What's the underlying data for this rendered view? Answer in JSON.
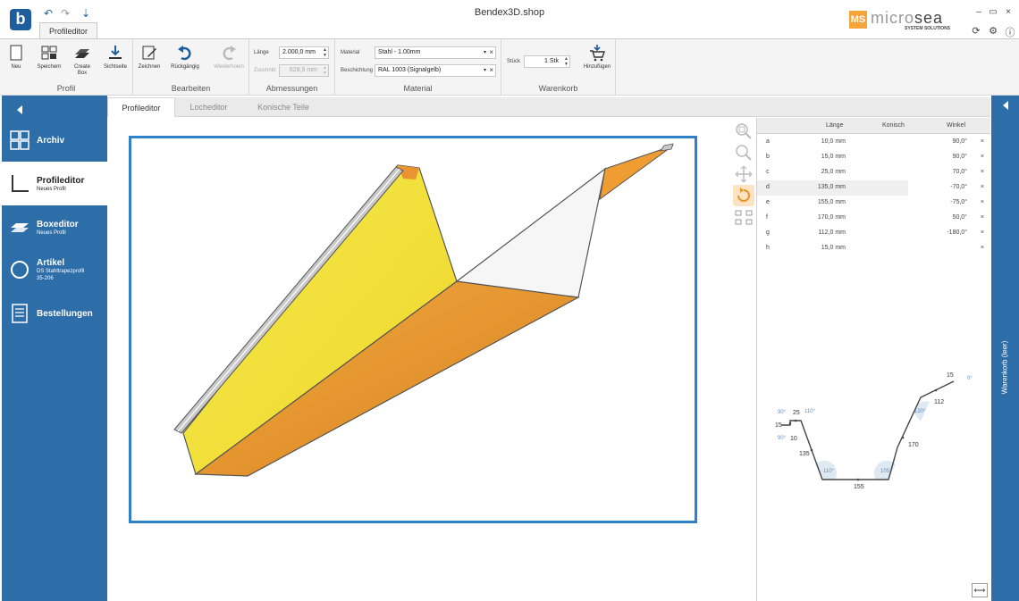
{
  "app": {
    "title": "Bendex3D.shop",
    "active_ribbon_tab": "Profileditor",
    "brand": {
      "mark": "MS",
      "word_light": "micro",
      "word_dark": "sea",
      "sub": "SYSTEM SOLUTIONS"
    }
  },
  "window": {
    "minimize": "–",
    "restore": "▭",
    "close": "×"
  },
  "ribbon": {
    "groups": {
      "profil": "Profil",
      "bearbeiten": "Bearbeiten",
      "abmessungen": "Abmessungen",
      "material": "Material",
      "warenkorb": "Warenkorb"
    },
    "buttons": {
      "neu": "Neu",
      "speichern": "Speichern",
      "create_box_1": "Create",
      "create_box_2": "Box",
      "sichtseite": "Sichtseite",
      "zeichnen": "Zeichnen",
      "rueckgaengig": "Rückgängig",
      "wiederholen": "Wiederholen",
      "hinzufuegen": "Hinzufügen"
    },
    "fields": {
      "laenge_label": "Länge",
      "laenge_value": "2.000,0 mm",
      "zuschnitt_label": "Zuschnitt",
      "zuschnitt_value": "628,9 mm",
      "material_label": "Material",
      "material_value": "Stahl - 1.00mm",
      "beschichtung_label": "Beschichtung",
      "beschichtung_value": "RAL 1003 (Signalgelb)",
      "stueck_label": "Stück",
      "stueck_value": "1 Stk"
    }
  },
  "sidebar": {
    "items": [
      {
        "title": "Archiv",
        "sub": ""
      },
      {
        "title": "Profileditor",
        "sub": "Neues Profil"
      },
      {
        "title": "Boxeditor",
        "sub": "Neues Profil"
      },
      {
        "title": "Artikel",
        "sub": "DS Stahltrapezprofil",
        "sub2": "35-206"
      },
      {
        "title": "Bestellungen",
        "sub": ""
      }
    ]
  },
  "tabs": [
    "Profileditor",
    "Locheditor",
    "Konische Teile"
  ],
  "table": {
    "headers": {
      "laenge": "Länge",
      "konisch": "Konisch",
      "winkel": "Winkel"
    },
    "rows": [
      {
        "id": "a",
        "laenge": "10,0 mm",
        "winkel": "90,0°"
      },
      {
        "id": "b",
        "laenge": "15,0 mm",
        "winkel": "90,0°"
      },
      {
        "id": "c",
        "laenge": "25,0 mm",
        "winkel": "70,0°"
      },
      {
        "id": "d",
        "laenge": "135,0 mm",
        "winkel": "-70,0°"
      },
      {
        "id": "e",
        "laenge": "155,0 mm",
        "winkel": "-75,0°"
      },
      {
        "id": "f",
        "laenge": "170,0 mm",
        "winkel": "50,0°"
      },
      {
        "id": "g",
        "laenge": "112,0 mm",
        "winkel": "-180,0°"
      },
      {
        "id": "h",
        "laenge": "15,0 mm",
        "winkel": ""
      }
    ]
  },
  "profile_labels": {
    "l15a": "15",
    "l25": "25",
    "l10": "10",
    "l135": "135",
    "l155": "155",
    "l170": "170",
    "l112": "112",
    "l15b": "15",
    "a90a": "90°",
    "a110a": "110°",
    "a90b": "90°",
    "a110b": "110°",
    "a105": "105°",
    "a130": "130°",
    "a0": "0°"
  },
  "warenkorb_label": "Warenkorb (leer)",
  "colors": {
    "accent": "#2d6da8",
    "yellow": "#f3e03a",
    "orange": "#e8962a"
  }
}
